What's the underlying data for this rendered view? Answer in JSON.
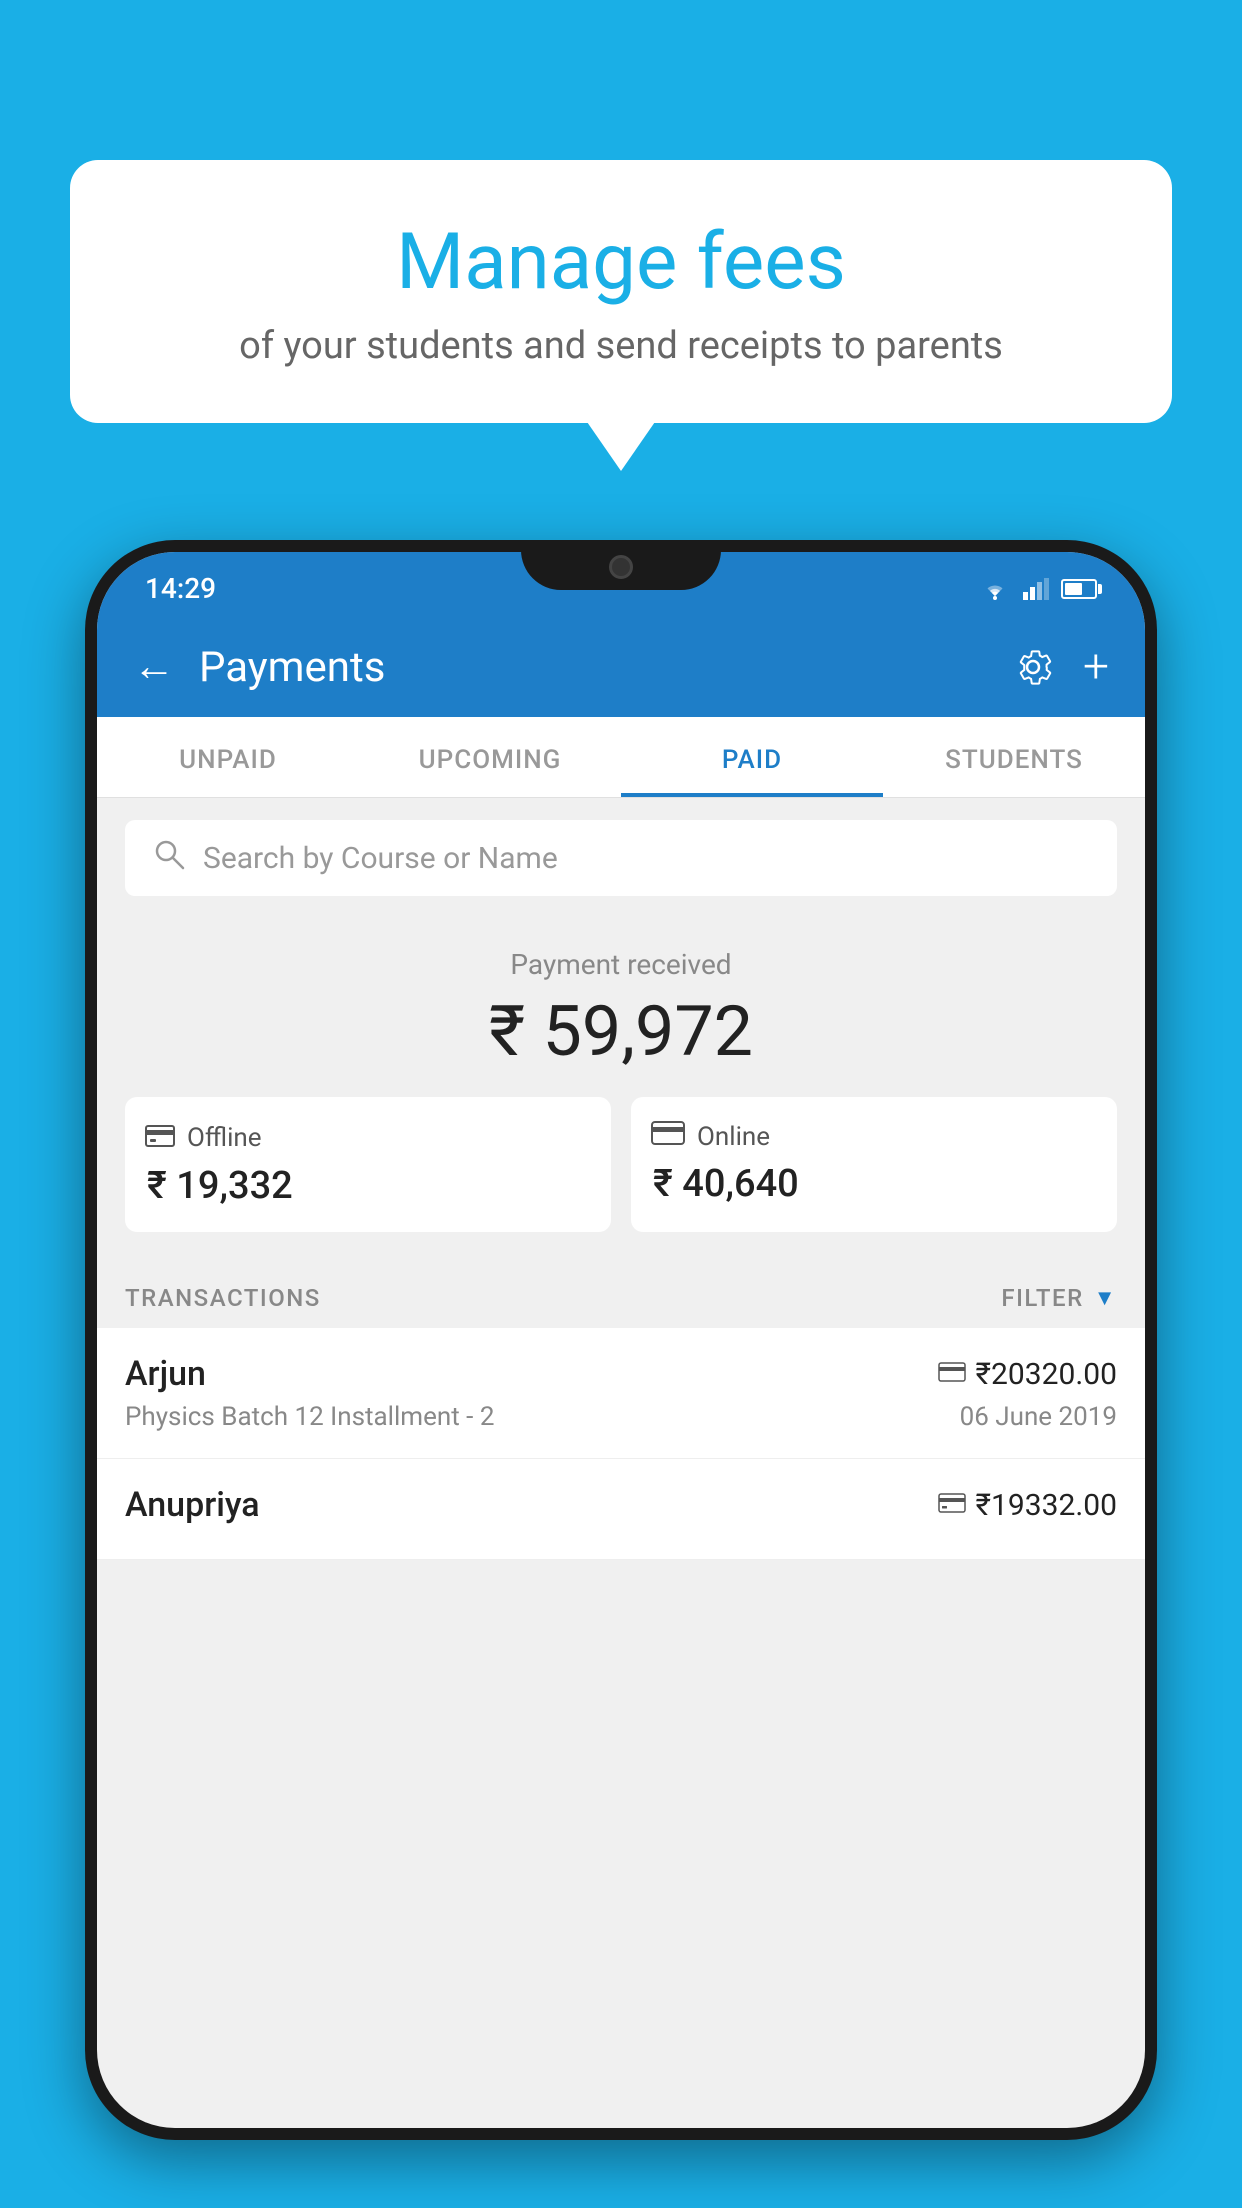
{
  "background_color": "#1AAFE6",
  "speech_bubble": {
    "title": "Manage fees",
    "subtitle": "of your students and send receipts to parents"
  },
  "phone": {
    "status_bar": {
      "time": "14:29"
    },
    "header": {
      "title": "Payments",
      "back_label": "←",
      "settings_label": "⚙",
      "add_label": "+"
    },
    "tabs": [
      {
        "label": "UNPAID",
        "active": false
      },
      {
        "label": "UPCOMING",
        "active": false
      },
      {
        "label": "PAID",
        "active": true
      },
      {
        "label": "STUDENTS",
        "active": false
      }
    ],
    "search": {
      "placeholder": "Search by Course or Name"
    },
    "payment_summary": {
      "label": "Payment received",
      "amount": "₹ 59,972",
      "offline": {
        "label": "Offline",
        "amount": "₹ 19,332"
      },
      "online": {
        "label": "Online",
        "amount": "₹ 40,640"
      }
    },
    "transactions": {
      "header": "TRANSACTIONS",
      "filter_label": "FILTER",
      "items": [
        {
          "name": "Arjun",
          "amount": "₹20320.00",
          "description": "Physics Batch 12 Installment - 2",
          "date": "06 June 2019",
          "payment_type": "online"
        },
        {
          "name": "Anupriya",
          "amount": "₹19332.00",
          "description": "",
          "date": "",
          "payment_type": "offline"
        }
      ]
    }
  }
}
